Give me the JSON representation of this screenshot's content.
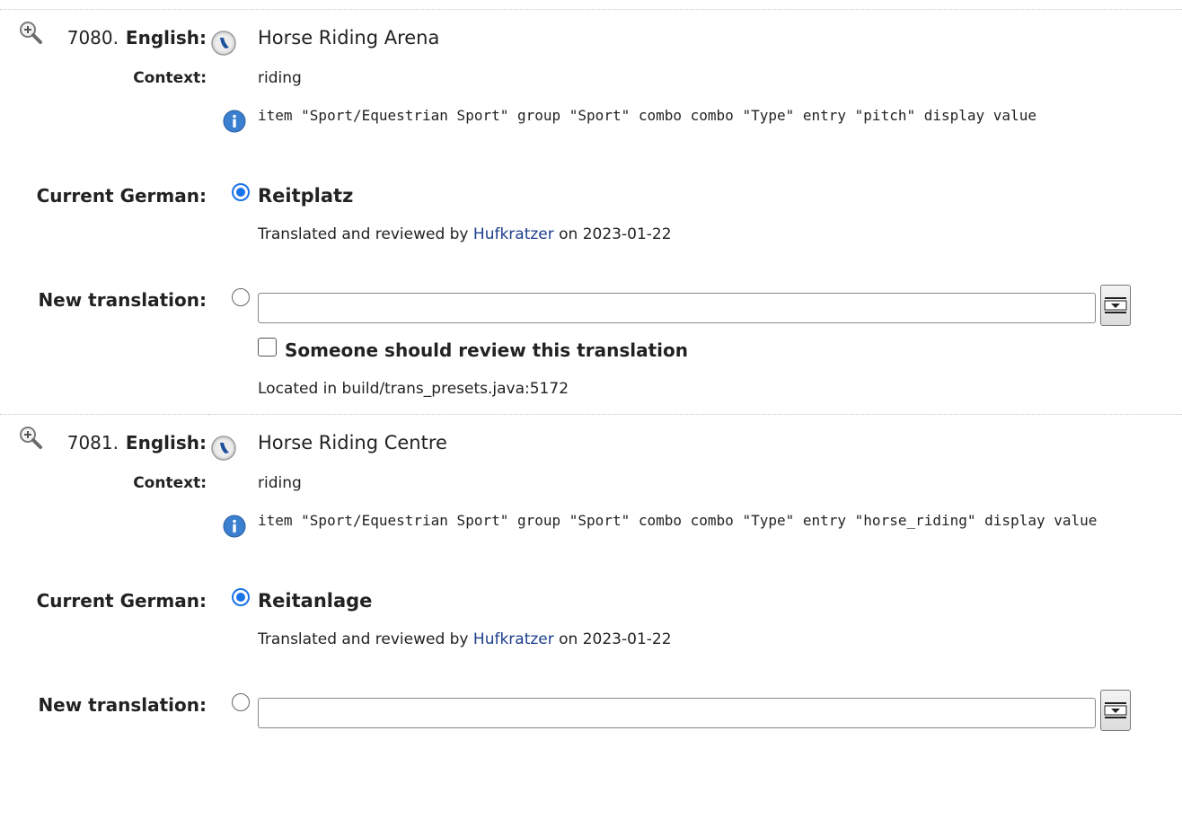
{
  "labels": {
    "english": "English:",
    "context": "Context:",
    "current": "Current German:",
    "new_translation": "New translation:",
    "review_checkbox": "Someone should review this translation"
  },
  "entries": [
    {
      "number": "7080.",
      "english": "Horse Riding Arena",
      "context": "riding",
      "comment": "item \"Sport/Equestrian Sport\" group \"Sport\" combo combo \"Type\" entry \"pitch\" display value",
      "current_translation": "Reitplatz",
      "reviewed_prefix": "Translated and reviewed by",
      "reviewer": "Hufkratzer",
      "reviewed_on": "on 2023-01-22",
      "new_translation_value": "",
      "located_in": "Located in build/trans_presets.java:5172"
    },
    {
      "number": "7081.",
      "english": "Horse Riding Centre",
      "context": "riding",
      "comment": "item \"Sport/Equestrian Sport\" group \"Sport\" combo combo \"Type\" entry \"horse_riding\" display value",
      "current_translation": "Reitanlage",
      "reviewed_prefix": "Translated and reviewed by",
      "reviewer": "Hufkratzer",
      "reviewed_on": "on 2023-01-22",
      "new_translation_value": ""
    }
  ],
  "colors": {
    "link": "#1c3d8c",
    "radio_selected": "#1a73e8",
    "separator": "#c8c8c8"
  }
}
